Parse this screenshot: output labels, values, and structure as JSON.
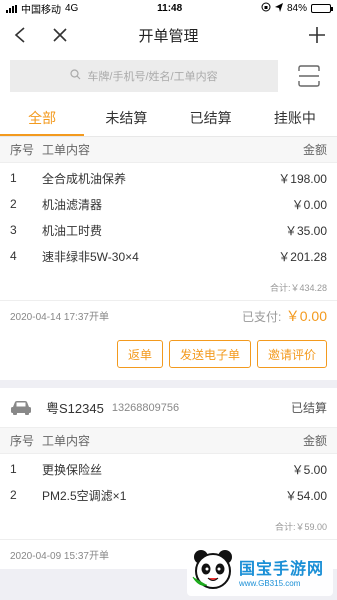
{
  "status_bar": {
    "carrier": "中国移动",
    "network": "4G",
    "time": "11:48",
    "battery_text": "84%",
    "battery_level": 0.84
  },
  "nav": {
    "title": "开单管理",
    "back_icon": "chevron-left-icon",
    "close_icon": "close-icon",
    "add_icon": "plus-icon"
  },
  "search": {
    "placeholder": "车牌/手机号/姓名/工单内容",
    "scan_icon": "scan-icon"
  },
  "tabs": [
    {
      "label": "全部",
      "active": true
    },
    {
      "label": "未结算",
      "active": false
    },
    {
      "label": "已结算",
      "active": false
    },
    {
      "label": "挂账中",
      "active": false
    }
  ],
  "table_headers": {
    "no": "序号",
    "content": "工单内容",
    "amount": "金额"
  },
  "orders": [
    {
      "items": [
        {
          "no": "1",
          "content": "全合成机油保养",
          "amount": "￥198.00"
        },
        {
          "no": "2",
          "content": "机油滤清器",
          "amount": "￥0.00"
        },
        {
          "no": "3",
          "content": "机油工时费",
          "amount": "￥35.00"
        },
        {
          "no": "4",
          "content": "速非绿非5W-30×4",
          "amount": "￥201.28"
        }
      ],
      "subtotal": "合计:￥434.28",
      "date": "2020-04-14 17:37开单",
      "paid_label": "已支付:",
      "paid_value": "￥0.00",
      "actions": [
        "返单",
        "发送电子单",
        "邀请评价"
      ]
    },
    {
      "plate": "粤S12345",
      "phone": "13268809756",
      "status": "已结算",
      "items": [
        {
          "no": "1",
          "content": "更换保险丝",
          "amount": "￥5.00"
        },
        {
          "no": "2",
          "content": "PM2.5空调滤×1",
          "amount": "￥54.00"
        }
      ],
      "subtotal": "合计:￥59.00",
      "date": "2020-04-09 15:37开单"
    }
  ],
  "watermark": {
    "brand": "国宝手游网",
    "url": "www.GB315.com"
  },
  "colors": {
    "accent": "#f39a1e",
    "background": "#efeff4",
    "watermark_blue": "#1a8fd6"
  }
}
